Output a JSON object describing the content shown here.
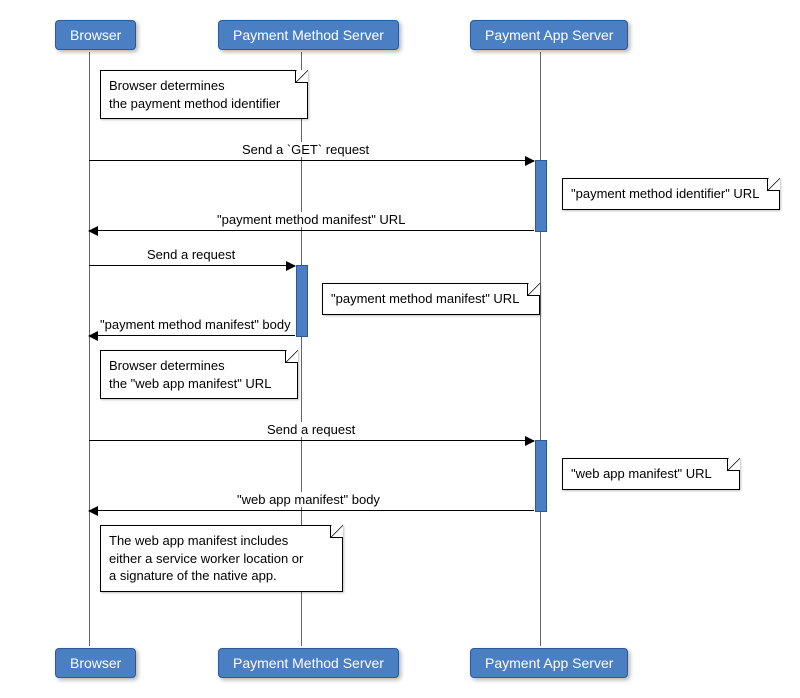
{
  "participants": {
    "browser": "Browser",
    "payment_method_server": "Payment Method Server",
    "payment_app_server": "Payment App Server"
  },
  "notes": {
    "n1_line1": "Browser determines",
    "n1_line2": "the payment method identifier",
    "n2": "\"payment method identifier\" URL",
    "n3": "\"payment method manifest\" URL",
    "n4_line1": "Browser determines",
    "n4_line2": "the \"web app manifest\" URL",
    "n5": "\"web app manifest\" URL",
    "n6_line1": "The web app manifest includes",
    "n6_line2": "either a service worker location or",
    "n6_line3": "a signature of the native app."
  },
  "messages": {
    "m1": "Send a `GET` request",
    "m2": "\"payment method manifest\" URL",
    "m3": "Send a request",
    "m4": "\"payment method manifest\" body",
    "m5": "Send a request",
    "m6": "\"web app manifest\" body"
  }
}
